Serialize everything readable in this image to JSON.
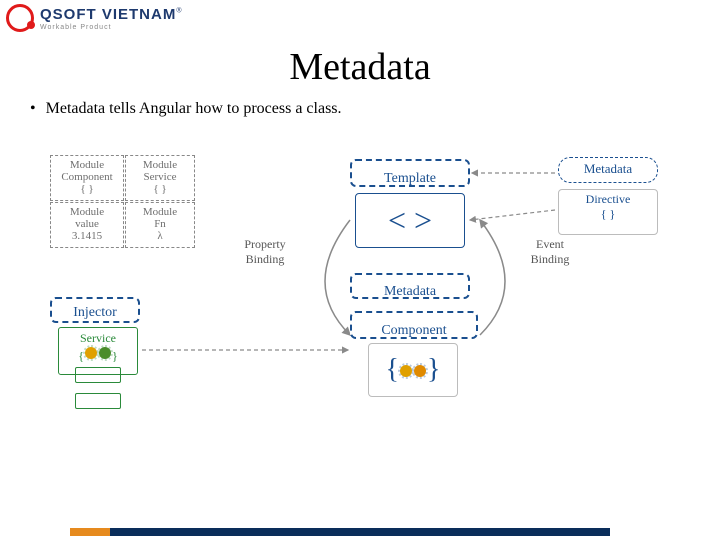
{
  "brand": {
    "name": "QSOFT VIETNAM",
    "sup": "®",
    "tagline": "Workable Product"
  },
  "slide": {
    "title": "Metadata",
    "bullet": "Metadata tells Angular how to process a class."
  },
  "diagram": {
    "modules": {
      "component": {
        "name": "Module\nComponent",
        "glyph": "{ }"
      },
      "service": {
        "name": "Module\nService",
        "glyph": "{ }"
      },
      "value": {
        "name": "Module\nvalue",
        "glyph": "3.1415"
      },
      "fn": {
        "name": "Module\nFn",
        "glyph": "λ"
      }
    },
    "injector": "Injector",
    "service": "Service",
    "template": "Template",
    "angle": "< >",
    "metadata": "Metadata",
    "component": "Component",
    "compBraces": "{ }",
    "propBinding": "Property\nBinding",
    "eventBinding": "Event\nBinding",
    "metaCloud": "Metadata",
    "directive": "Directive",
    "dirGlyph": "{ }"
  }
}
